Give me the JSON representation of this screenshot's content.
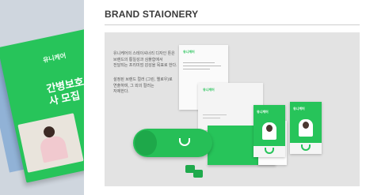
{
  "section": {
    "title": "BRAND STAIONERY"
  },
  "left_brochure": {
    "brand": "유니케어",
    "title": "간병보호사 모집"
  },
  "mockup": {
    "paragraph_1": "유니케어의 스테이셔너리 디자인 톤은\n브랜드의 통일성과 심플함에서\n전달되는 프리미엄 감성을 목표로 한다.",
    "paragraph_2": "설정된 브랜드 컬러 (그린, 옐로우)로\n연출하며, 그 외의 컬러는\n자제한다.",
    "letterhead_brand": "유니케어",
    "envelope_brand": "유니케어",
    "id_brand_a": "유니케어",
    "id_brand_b": "유니케어"
  },
  "colors": {
    "brand_green": "#27c45a",
    "text": "#3b3b3b"
  }
}
